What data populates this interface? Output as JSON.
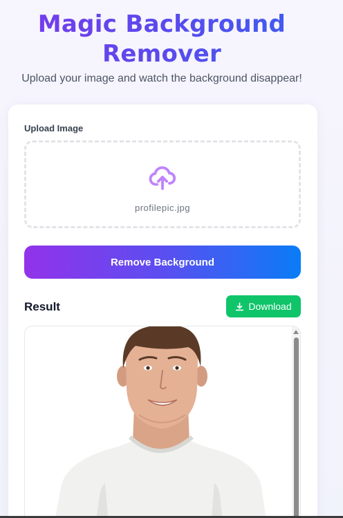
{
  "header": {
    "title_line1": "Magic Background",
    "title_line2": "Remover",
    "subtitle": "Upload your image and watch the background disappear!"
  },
  "upload": {
    "label": "Upload Image",
    "file_name": "profilepic.jpg",
    "icon": "cloud-upload-icon"
  },
  "actions": {
    "remove_label": "Remove Background"
  },
  "result": {
    "label": "Result",
    "download_label": "Download",
    "download_icon": "download-icon"
  },
  "colors": {
    "gradient_start": "#9333ea",
    "gradient_end": "#0a7cf6",
    "download_green": "#10c46a",
    "icon_purple": "#c084fc"
  }
}
